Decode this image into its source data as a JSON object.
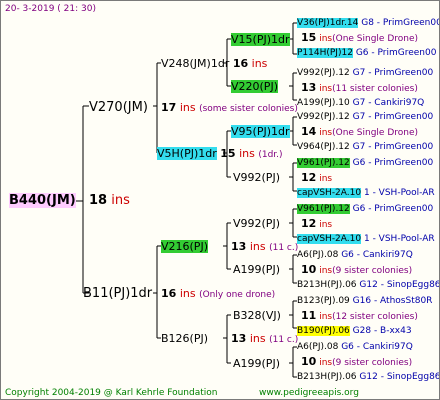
{
  "header_date": "20-   3-2019 (  21:  30)",
  "footer": {
    "copyright": "Copyright 2004-2019 @ Karl Kehrle Foundation",
    "site": "www.pedigreeapis.org"
  },
  "root": {
    "name": "B440(JM)",
    "num": "18",
    "unit": "ins"
  },
  "gen1": [
    {
      "name": "V270(JM)",
      "num": "17",
      "unit": "ins",
      "note": "(some sister colonies)"
    },
    {
      "name": "B11(PJ)1dr",
      "num": "16",
      "unit": "ins",
      "note": "(Only one drone)"
    }
  ],
  "gen2": [
    {
      "name": "V248(JM)1dr",
      "num": "16",
      "unit": "ins",
      "note": ""
    },
    {
      "name": "V5H(PJ)1dr",
      "num": "15",
      "unit": "ins",
      "note": "(1dr.)"
    },
    {
      "name": "V216(PJ)",
      "num": "13",
      "unit": "ins",
      "note": "(11 c.)"
    },
    {
      "name": "B126(PJ)",
      "num": "13",
      "unit": "ins",
      "note": "(11 c.)"
    }
  ],
  "gen3": [
    {
      "name": "V15(PJ)1dr",
      "num": "",
      "unit": ""
    },
    {
      "name": "V220(PJ)",
      "num": "",
      "unit": ""
    },
    {
      "name": "V95(PJ)1dr",
      "num": "",
      "unit": ""
    },
    {
      "name": "V992(PJ)",
      "num": "",
      "unit": ""
    },
    {
      "name": "V992(PJ)",
      "num": "",
      "unit": ""
    },
    {
      "name": "A199(PJ)",
      "num": "",
      "unit": ""
    },
    {
      "name": "B328(VJ)",
      "num": "",
      "unit": ""
    },
    {
      "name": "A199(PJ)",
      "num": "",
      "unit": ""
    }
  ],
  "gen4": [
    {
      "line1": "V36(PJ)1dr.14",
      "line1b": "G8 - PrimGreen00",
      "num": "15",
      "unit": "ins",
      "note": "(One Single Drone)",
      "line3": "P114H(PJ)12",
      "line3b": "G6 - PrimGreen00"
    },
    {
      "line1": "V992(PJ).12",
      "line1b": "G7 - PrimGreen00",
      "num": "13",
      "unit": "ins",
      "note": "(11 sister colonies)",
      "line3": "A199(PJ).10",
      "line3b": "G7 - Cankiri97Q"
    },
    {
      "line1": "V992(PJ).12",
      "line1b": "G7 - PrimGreen00",
      "num": "14",
      "unit": "ins",
      "note": "(One Single Drone)",
      "line3": "V964(PJ).12",
      "line3b": "G7 - PrimGreen00"
    },
    {
      "line1": "V961(PJ).12",
      "line1b": "G6 - PrimGreen00",
      "num": "12",
      "unit": "ins",
      "note": "",
      "line3": "capVSH-2A.10",
      "line3b": "1 - VSH-Pool-AR"
    },
    {
      "line1": "V961(PJ).12",
      "line1b": "G6 - PrimGreen00",
      "num": "12",
      "unit": "ins",
      "note": "",
      "line3": "capVSH-2A.10",
      "line3b": "1 - VSH-Pool-AR"
    },
    {
      "line1": "A6(PJ).08",
      "line1b": "G6 - Cankiri97Q",
      "num": "10",
      "unit": "ins",
      "note": "(9 sister colonies)",
      "line3": "B213H(PJ).06",
      "line3b": "G12 - SinopEgg86R"
    },
    {
      "line1": "B123(PJ).09",
      "line1b": "G16 - AthosSt80R",
      "num": "11",
      "unit": "ins",
      "note": "(12 sister colonies)",
      "line3": "B190(PJ).06",
      "line3b": "G28 - B-xx43"
    },
    {
      "line1": "A6(PJ).08",
      "line1b": "G6 - Cankiri97Q",
      "num": "10",
      "unit": "ins",
      "note": "(9 sister colonies)",
      "line3": "B213H(PJ).06",
      "line3b": "G12 - SinopEgg86R"
    }
  ],
  "colors": {
    "green": "#33cc33",
    "cyan": "#33ddee",
    "yellow": "#ffff00",
    "pink": "#ffccff",
    "red": "#cc0000",
    "purple": "#800080"
  }
}
